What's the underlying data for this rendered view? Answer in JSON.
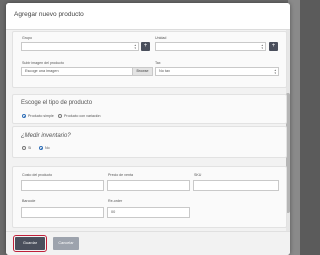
{
  "modal": {
    "title": "Agregar nuevo producto"
  },
  "details": {
    "group_label": "Grupo",
    "group_value": "",
    "unit_label": "Unidad",
    "unit_value": "",
    "add_symbol": "+",
    "image_label": "Subir imagen del producto",
    "image_placeholder": "Escoge una imagen",
    "browse_label": "Browse",
    "tax_label": "Tax",
    "tax_value": "No tax"
  },
  "product_type": {
    "heading": "Escoge el tipo de producto",
    "options": [
      "Producto simple",
      "Producto con variación"
    ],
    "selected": "Producto simple"
  },
  "inventory": {
    "heading": "¿Medir inventario?",
    "options": [
      "Si",
      "No"
    ],
    "selected": "No"
  },
  "pricing": {
    "cost_label": "Costo del producto",
    "cost_value": "",
    "price_label": "Precio de venta",
    "price_value": "",
    "sku_label": "SKU",
    "sku_value": "",
    "barcode_label": "Barcode",
    "barcode_value": "",
    "reorder_label": "Re-order",
    "reorder_value": "00"
  },
  "footer": {
    "save_label": "Guardar",
    "cancel_label": "Cancelar"
  },
  "colors": {
    "primary": "#4a4f5c",
    "highlight": "#c0203a",
    "radio": "#2f6fb7"
  }
}
